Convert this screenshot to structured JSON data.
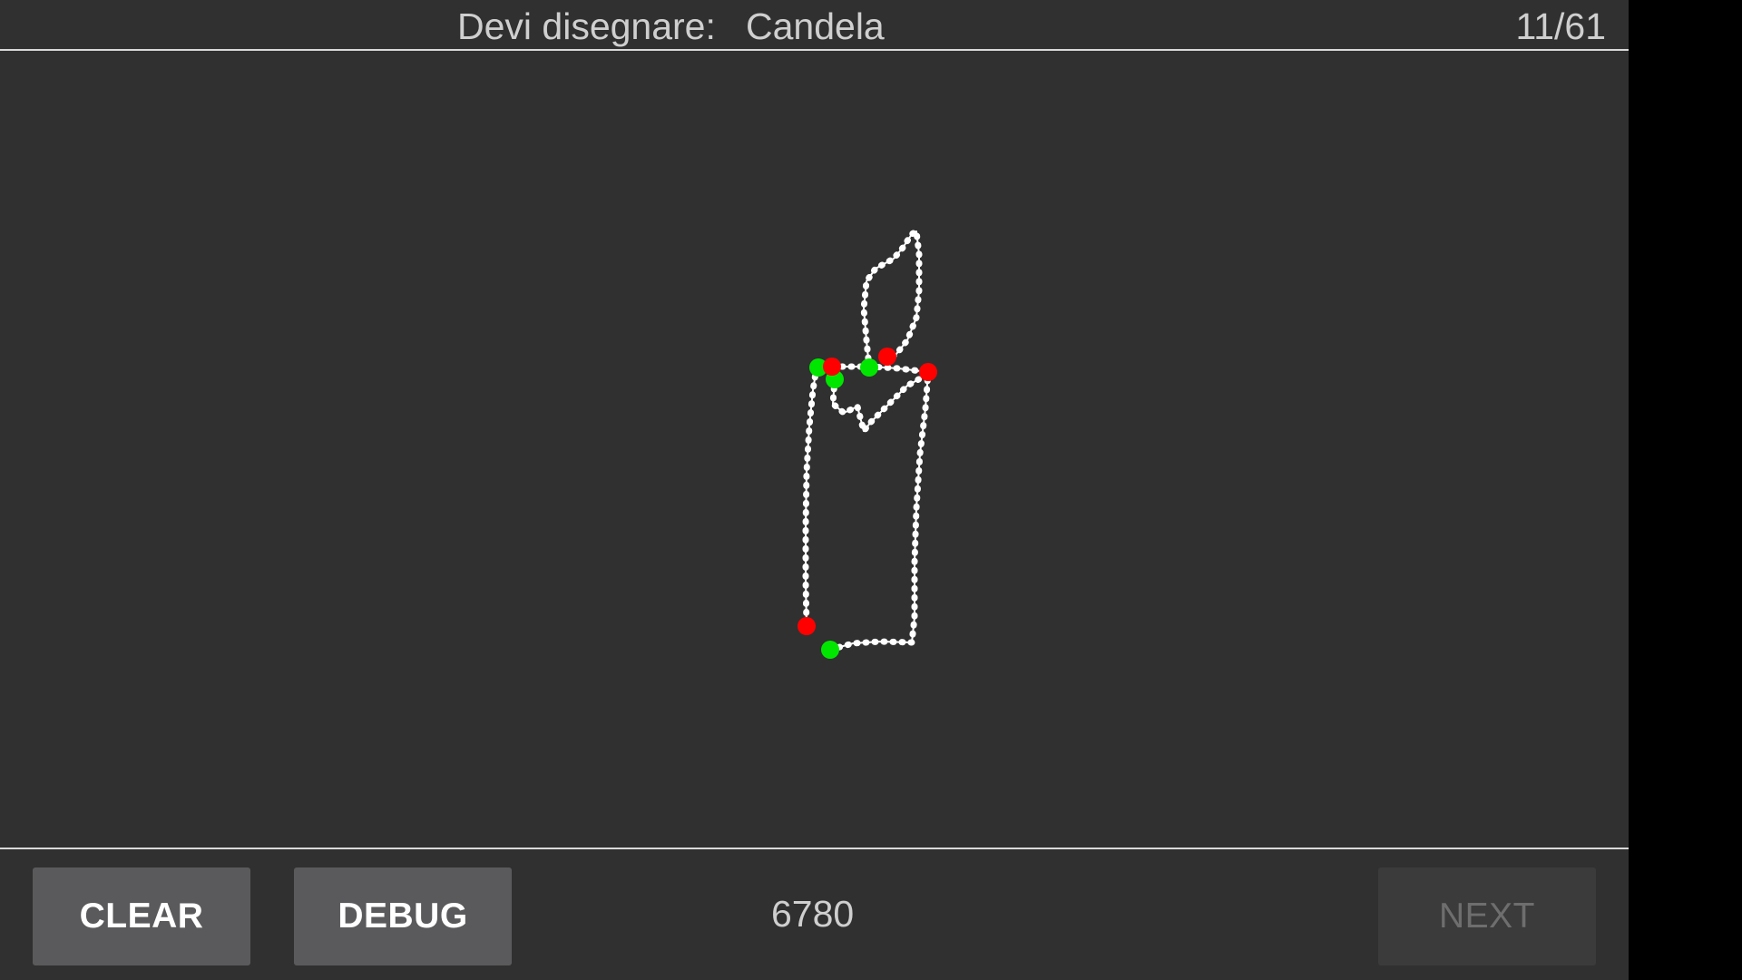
{
  "header": {
    "prompt_label": "Devi disegnare:",
    "prompt_word": "Candela",
    "progress": "11/61"
  },
  "footer": {
    "clear_label": "CLEAR",
    "debug_label": "DEBUG",
    "score": "6780",
    "next_label": "NEXT"
  },
  "colors": {
    "background": "#303030",
    "stroke": "#ffffff",
    "stroke_start": "#00e600",
    "stroke_end": "#ff0000",
    "button": "#5a5a5c",
    "button_disabled": "#3b3b3b"
  }
}
